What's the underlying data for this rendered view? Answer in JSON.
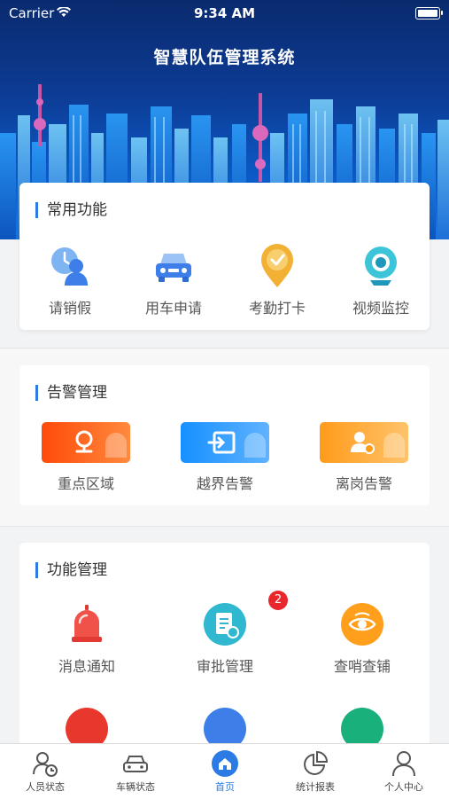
{
  "status_bar": {
    "carrier": "Carrier",
    "time": "9:34 AM"
  },
  "app_title": "智慧队伍管理系统",
  "common": {
    "title": "常用功能",
    "items": [
      {
        "label": "请销假",
        "icon": "leave-icon"
      },
      {
        "label": "用车申请",
        "icon": "car-icon"
      },
      {
        "label": "考勤打卡",
        "icon": "checkin-icon"
      },
      {
        "label": "视频监控",
        "icon": "camera-icon"
      }
    ]
  },
  "alarms": {
    "title": "告警管理",
    "items": [
      {
        "label": "重点区域",
        "color": "#ff5a0f"
      },
      {
        "label": "越界告警",
        "color": "#1e9bff"
      },
      {
        "label": "离岗告警",
        "color": "#ffa21e"
      }
    ]
  },
  "functions": {
    "title": "功能管理",
    "items": [
      {
        "label": "消息通知"
      },
      {
        "label": "审批管理",
        "badge": "2"
      },
      {
        "label": "查哨查铺"
      }
    ]
  },
  "tabbar": {
    "items": [
      {
        "label": "人员状态"
      },
      {
        "label": "车辆状态"
      },
      {
        "label": "首页"
      },
      {
        "label": "统计报表"
      },
      {
        "label": "个人中心"
      }
    ],
    "active": "首页",
    "accent": "#2c7be5"
  }
}
